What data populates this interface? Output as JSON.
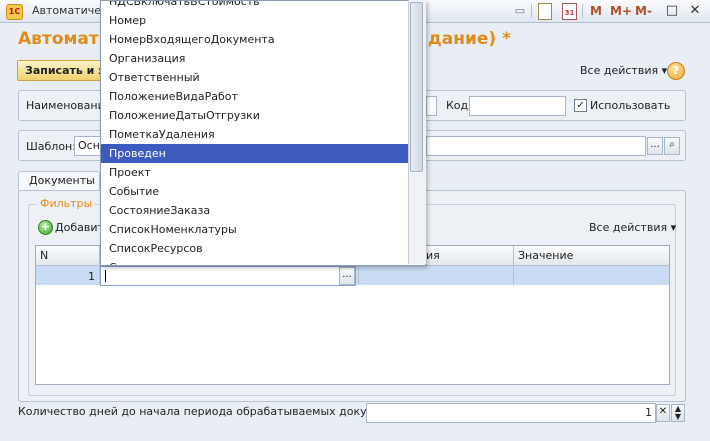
{
  "window": {
    "title": "Автоматичес",
    "m_buttons": [
      "M",
      "M+",
      "M-"
    ]
  },
  "form": {
    "title_left": "Автомати",
    "title_right": "дание) *",
    "save_label": "Записать и з",
    "all_actions": "Все действия ▾",
    "help": "?"
  },
  "fields": {
    "name_label": "Наименование",
    "code_label": "Код:",
    "code_value": "",
    "use_label": "Использовать",
    "use_checked": "✓",
    "template_label": "Шаблон:",
    "template_value": "Осно"
  },
  "tabs": [
    {
      "label": "Документы"
    }
  ],
  "filters": {
    "legend": "Фильтры",
    "add_label": "Добавит",
    "all_actions": "Все действия ▾",
    "columns": [
      "N",
      "ия",
      "Значение"
    ],
    "rows": [
      {
        "n": "1",
        "value": ""
      }
    ]
  },
  "dropdown": {
    "items": [
      "НДСВключатьВСтоимость",
      "Номер",
      "НомерВходящегоДокумента",
      "Организация",
      "Ответственный",
      "ПоложениеВидаРабот",
      "ПоложениеДатыОтгрузки",
      "ПометкаУдаления",
      "Проведен",
      "Проект",
      "Событие",
      "СостояниеЗаказа",
      "СписокНоменклатуры",
      "СписокРесурсов",
      "Ссылка"
    ],
    "selected_index": 8
  },
  "footer": {
    "days_label": "Количество дней до начала периода обрабатываемых документов:",
    "days_value": "1"
  }
}
